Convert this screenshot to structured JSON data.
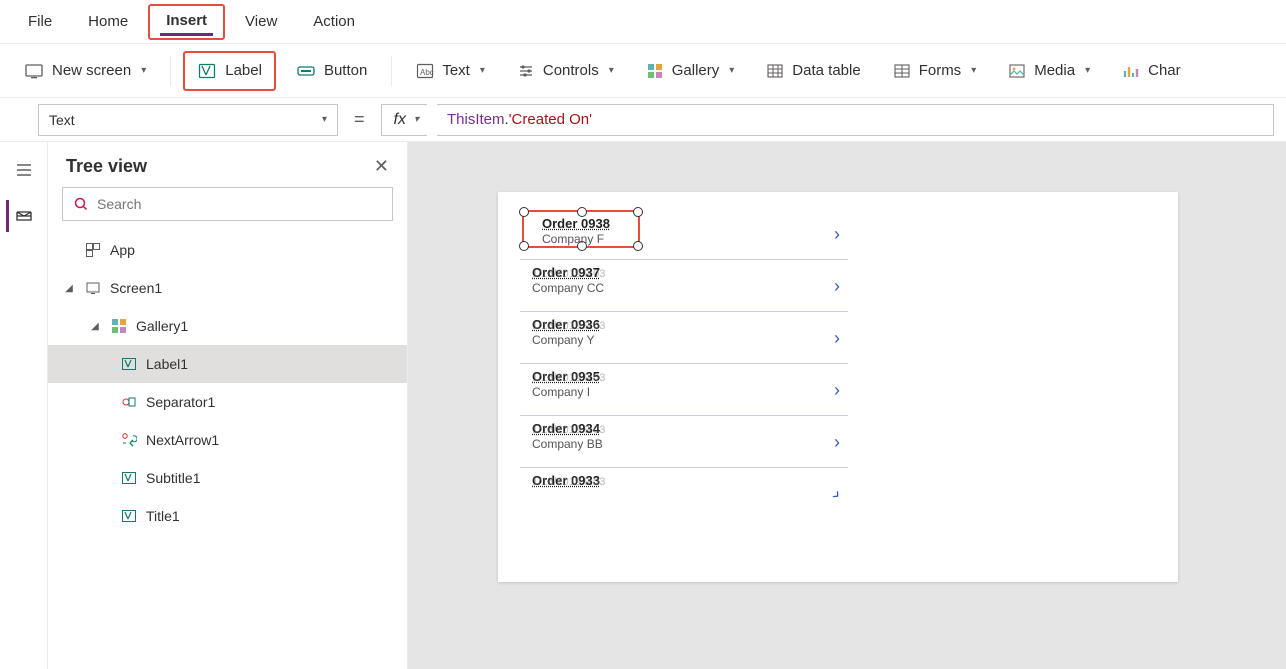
{
  "menu": {
    "file": "File",
    "home": "Home",
    "insert": "Insert",
    "view": "View",
    "action": "Action"
  },
  "ribbon": {
    "new_screen": "New screen",
    "label": "Label",
    "button": "Button",
    "text": "Text",
    "controls": "Controls",
    "gallery": "Gallery",
    "data_table": "Data table",
    "forms": "Forms",
    "media": "Media",
    "charts": "Char"
  },
  "formula": {
    "property": "Text",
    "equals": "=",
    "fx": "fx",
    "token_this": "ThisItem",
    "token_dot": ".",
    "token_col": "'Created On'"
  },
  "tree": {
    "title": "Tree view",
    "search_placeholder": "Search",
    "app": "App",
    "screen1": "Screen1",
    "gallery1": "Gallery1",
    "label1": "Label1",
    "separator1": "Separator1",
    "nextarrow1": "NextArrow1",
    "subtitle1": "Subtitle1",
    "title1": "Title1"
  },
  "gallery_items": [
    {
      "title": "Order 0938",
      "date": "1/18/2019 9:03",
      "sub": "Company F"
    },
    {
      "title": "Order 0937",
      "date": "1/18/2019 9:03",
      "sub": "Company CC"
    },
    {
      "title": "Order 0936",
      "date": "1/18/2019 9:03",
      "sub": "Company Y"
    },
    {
      "title": "Order 0935",
      "date": "1/18/2019 9:03",
      "sub": "Company I"
    },
    {
      "title": "Order 0934",
      "date": "1/18/2019 9:03",
      "sub": "Company BB"
    },
    {
      "title": "Order 0933",
      "date": "1/18/2019 9:03",
      "sub": ""
    }
  ]
}
